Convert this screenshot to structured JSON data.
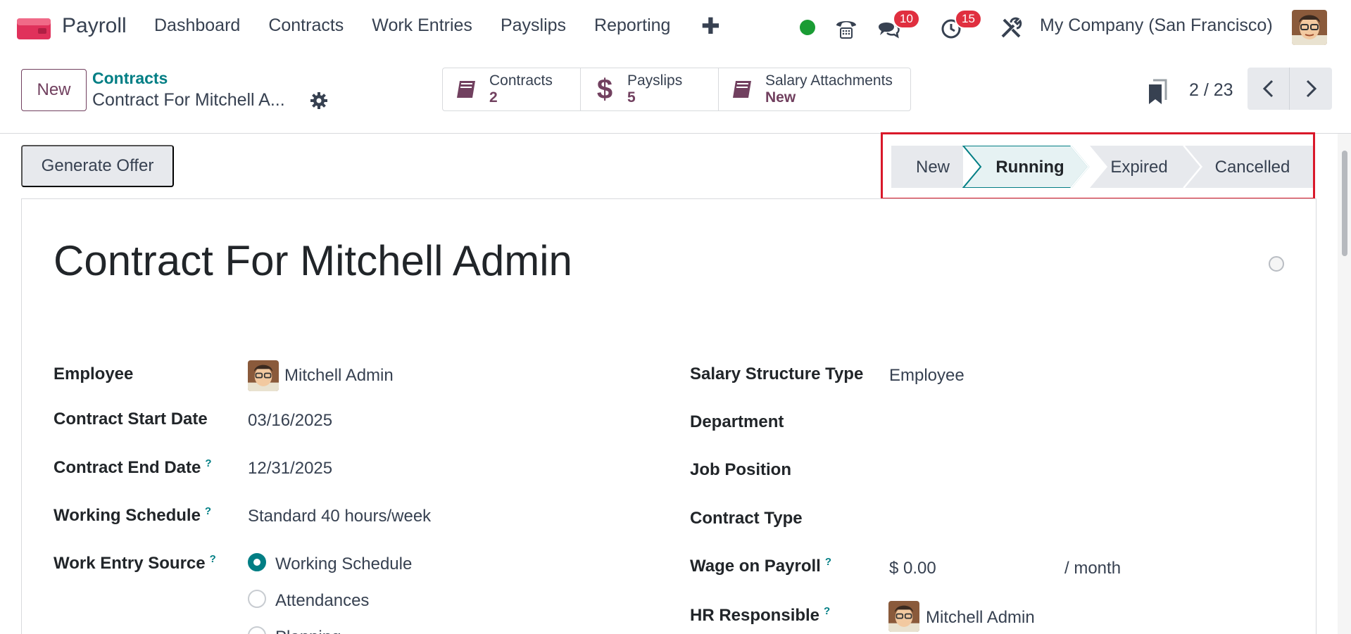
{
  "navbar": {
    "app_name": "Payroll",
    "menu": [
      "Dashboard",
      "Contracts",
      "Work Entries",
      "Payslips",
      "Reporting"
    ],
    "messages_count": "10",
    "activities_count": "15",
    "company": "My Company (San Francisco)"
  },
  "control": {
    "new_label": "New",
    "breadcrumb_parent": "Contracts",
    "breadcrumb_current": "Contract For Mitchell A...",
    "smart_buttons": [
      {
        "label": "Contracts",
        "value": "2"
      },
      {
        "label": "Payslips",
        "value": "5"
      },
      {
        "label": "Salary Attachments",
        "value": "New"
      }
    ],
    "pager": "2 / 23"
  },
  "actions": {
    "generate_offer": "Generate Offer"
  },
  "statusbar": {
    "stages": [
      "New",
      "Running",
      "Expired",
      "Cancelled"
    ],
    "current": "Running"
  },
  "form": {
    "title": "Contract For Mitchell Admin",
    "left": {
      "employee_label": "Employee",
      "employee_value": "Mitchell Admin",
      "start_label": "Contract Start Date",
      "start_value": "03/16/2025",
      "end_label": "Contract End Date",
      "end_value": "12/31/2025",
      "schedule_label": "Working Schedule",
      "schedule_value": "Standard 40 hours/week",
      "source_label": "Work Entry Source",
      "source_options": [
        "Working Schedule",
        "Attendances",
        "Planning"
      ]
    },
    "right": {
      "structure_label": "Salary Structure Type",
      "structure_value": "Employee",
      "department_label": "Department",
      "job_label": "Job Position",
      "contract_type_label": "Contract Type",
      "wage_label": "Wage on Payroll",
      "wage_value": "$ 0.00",
      "wage_period": "/ month",
      "hr_label": "HR Responsible",
      "hr_value": "Mitchell Admin"
    },
    "help_mark": "?"
  },
  "colors": {
    "brand": "#71405f",
    "accent": "#017e84",
    "badge": "#e02f3f",
    "highlight": "#d9182a"
  }
}
